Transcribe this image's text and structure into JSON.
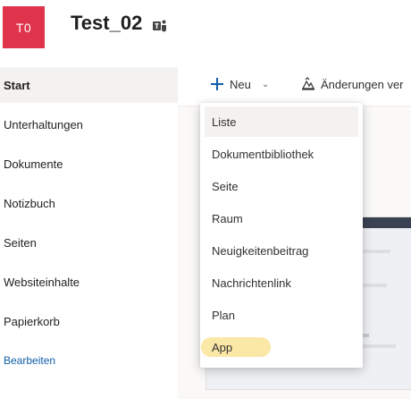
{
  "site": {
    "logo_text": "T0",
    "logo_color": "#e0344d",
    "title": "Test_02",
    "title_icon": "teams-icon"
  },
  "leftnav": {
    "items": [
      {
        "label": "Start",
        "active": true
      },
      {
        "label": "Unterhaltungen"
      },
      {
        "label": "Dokumente"
      },
      {
        "label": "Notizbuch"
      },
      {
        "label": "Seiten"
      },
      {
        "label": "Websiteinhalte"
      },
      {
        "label": "Papierkorb"
      }
    ],
    "edit_label": "Bearbeiten"
  },
  "commandbar": {
    "new_label": "Neu",
    "new_icon": "plus-icon",
    "changes_label": "Änderungen ver",
    "changes_icon": "changes-icon"
  },
  "new_menu": {
    "items": [
      {
        "label": "Liste",
        "hovered": true
      },
      {
        "label": "Dokumentbibliothek"
      },
      {
        "label": "Seite"
      },
      {
        "label": "Raum"
      },
      {
        "label": "Neuigkeitenbeitrag"
      },
      {
        "label": "Nachrichtenlink"
      },
      {
        "label": "Plan"
      },
      {
        "label": "App",
        "highlighted": true
      }
    ],
    "highlight_color": "#fbe7a6"
  },
  "colors": {
    "accent": "#0f5ea8",
    "nav_active_bg": "#f3f2f1"
  }
}
